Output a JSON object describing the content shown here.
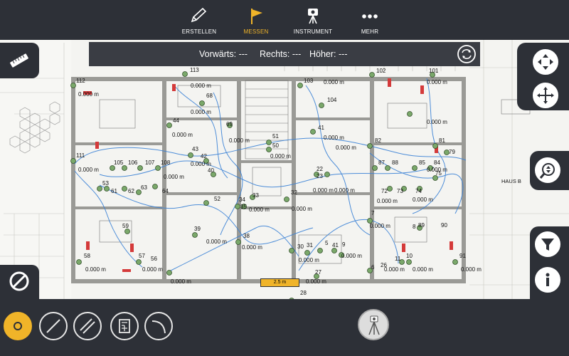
{
  "top_tabs": [
    {
      "label": "ERSTELLEN",
      "icon": "pencil-icon"
    },
    {
      "label": "MESSEN",
      "icon": "flag-icon"
    },
    {
      "label": "INSTRUMENT",
      "icon": "instrument-icon"
    },
    {
      "label": "MEHR",
      "icon": "more-dots-icon"
    }
  ],
  "readout": {
    "forward": "Vorwärts: ---",
    "right": "Rechts: ---",
    "height": "Höher: ---"
  },
  "scale_label": "2.5 m",
  "haus_label": "HAUS B",
  "point_labels": [
    "112",
    "113",
    "103",
    "102",
    "101",
    "68",
    "104",
    "44",
    "69",
    "51",
    "50",
    "41",
    "82",
    "81",
    "79",
    "111",
    "106",
    "105",
    "107",
    "108",
    "43",
    "42",
    "40",
    "87",
    "88",
    "85",
    "84",
    "53",
    "61",
    "62",
    "63",
    "64",
    "72",
    "73",
    "74",
    "75",
    "52",
    "34",
    "35",
    "33",
    "32",
    "22",
    "23",
    "39",
    "38",
    "30",
    "31",
    "5",
    "41",
    "9",
    "59",
    "58",
    "57",
    "56",
    "11",
    "10",
    "91",
    "28",
    "27",
    "26",
    "6",
    "7",
    "8",
    "89",
    "90"
  ],
  "distance_label": "0.000 m",
  "bottom_tools": [
    "circle-point-tool",
    "line-tool",
    "double-line-tool",
    "floorplan-tool",
    "arc-tool"
  ],
  "colors": {
    "bar": "#2d3037",
    "accent": "#f0b429",
    "point": "#7aa86a",
    "route": "#3b82d6"
  }
}
